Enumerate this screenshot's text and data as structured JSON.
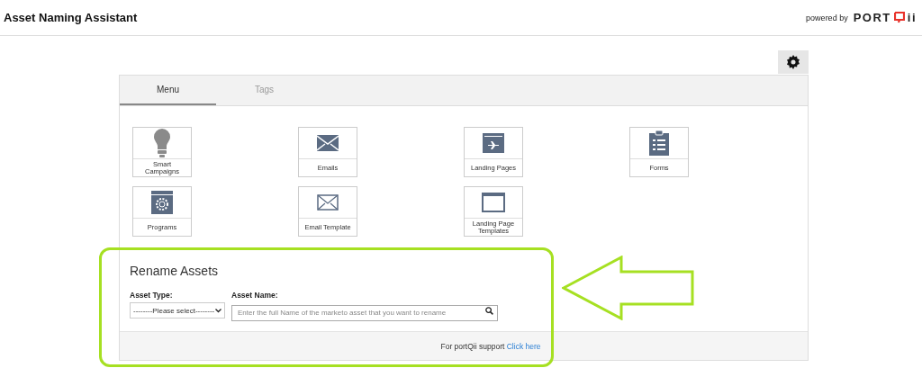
{
  "header": {
    "title": "Asset Naming Assistant",
    "powered_by": "powered by",
    "logo_left": "PORT",
    "logo_right": "ii"
  },
  "tabs": [
    {
      "label": "Menu",
      "selected": true
    },
    {
      "label": "Tags",
      "selected": false
    }
  ],
  "tiles": [
    {
      "label": "Smart Campaigns",
      "kind": "bulb"
    },
    {
      "label": "Emails",
      "kind": "envelope"
    },
    {
      "label": "Landing Pages",
      "kind": "plane"
    },
    {
      "label": "Forms",
      "kind": "clipboard"
    },
    {
      "label": "Programs",
      "kind": "gearwindow"
    },
    {
      "label": "Email Template",
      "kind": "envelopeoutline"
    },
    {
      "label": "Landing Page Templates",
      "kind": "window"
    }
  ],
  "rename": {
    "title": "Rename Assets",
    "type_label": "Asset Type:",
    "type_value": "--------Please select--------",
    "name_label": "Asset Name:",
    "name_placeholder": "Enter the full Name of the marketo asset that you want to rename"
  },
  "footer": {
    "text": "For portQii support",
    "link": "Click here"
  }
}
